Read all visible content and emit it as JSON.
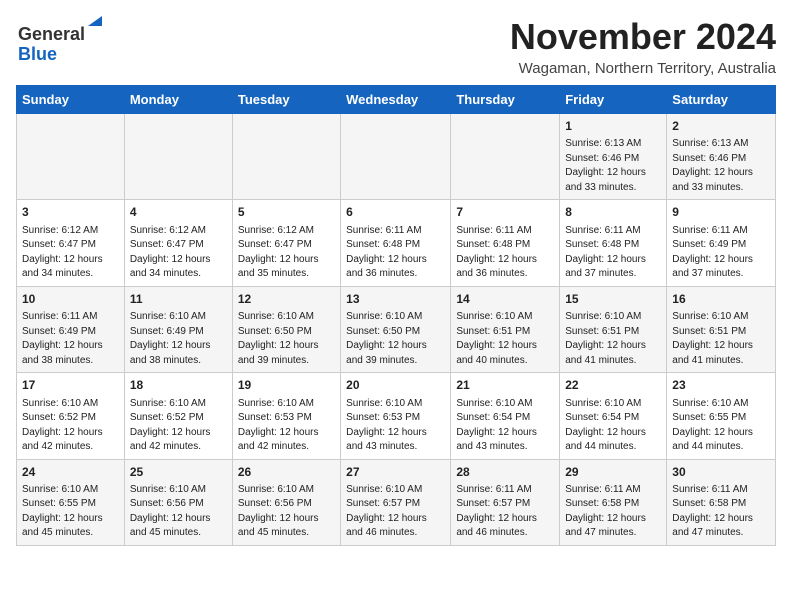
{
  "header": {
    "logo_line1": "General",
    "logo_line2": "Blue",
    "month_title": "November 2024",
    "subtitle": "Wagaman, Northern Territory, Australia"
  },
  "calendar": {
    "days_of_week": [
      "Sunday",
      "Monday",
      "Tuesday",
      "Wednesday",
      "Thursday",
      "Friday",
      "Saturday"
    ],
    "weeks": [
      [
        {
          "day": "",
          "info": ""
        },
        {
          "day": "",
          "info": ""
        },
        {
          "day": "",
          "info": ""
        },
        {
          "day": "",
          "info": ""
        },
        {
          "day": "",
          "info": ""
        },
        {
          "day": "1",
          "info": "Sunrise: 6:13 AM\nSunset: 6:46 PM\nDaylight: 12 hours and 33 minutes."
        },
        {
          "day": "2",
          "info": "Sunrise: 6:13 AM\nSunset: 6:46 PM\nDaylight: 12 hours and 33 minutes."
        }
      ],
      [
        {
          "day": "3",
          "info": "Sunrise: 6:12 AM\nSunset: 6:47 PM\nDaylight: 12 hours and 34 minutes."
        },
        {
          "day": "4",
          "info": "Sunrise: 6:12 AM\nSunset: 6:47 PM\nDaylight: 12 hours and 34 minutes."
        },
        {
          "day": "5",
          "info": "Sunrise: 6:12 AM\nSunset: 6:47 PM\nDaylight: 12 hours and 35 minutes."
        },
        {
          "day": "6",
          "info": "Sunrise: 6:11 AM\nSunset: 6:48 PM\nDaylight: 12 hours and 36 minutes."
        },
        {
          "day": "7",
          "info": "Sunrise: 6:11 AM\nSunset: 6:48 PM\nDaylight: 12 hours and 36 minutes."
        },
        {
          "day": "8",
          "info": "Sunrise: 6:11 AM\nSunset: 6:48 PM\nDaylight: 12 hours and 37 minutes."
        },
        {
          "day": "9",
          "info": "Sunrise: 6:11 AM\nSunset: 6:49 PM\nDaylight: 12 hours and 37 minutes."
        }
      ],
      [
        {
          "day": "10",
          "info": "Sunrise: 6:11 AM\nSunset: 6:49 PM\nDaylight: 12 hours and 38 minutes."
        },
        {
          "day": "11",
          "info": "Sunrise: 6:10 AM\nSunset: 6:49 PM\nDaylight: 12 hours and 38 minutes."
        },
        {
          "day": "12",
          "info": "Sunrise: 6:10 AM\nSunset: 6:50 PM\nDaylight: 12 hours and 39 minutes."
        },
        {
          "day": "13",
          "info": "Sunrise: 6:10 AM\nSunset: 6:50 PM\nDaylight: 12 hours and 39 minutes."
        },
        {
          "day": "14",
          "info": "Sunrise: 6:10 AM\nSunset: 6:51 PM\nDaylight: 12 hours and 40 minutes."
        },
        {
          "day": "15",
          "info": "Sunrise: 6:10 AM\nSunset: 6:51 PM\nDaylight: 12 hours and 41 minutes."
        },
        {
          "day": "16",
          "info": "Sunrise: 6:10 AM\nSunset: 6:51 PM\nDaylight: 12 hours and 41 minutes."
        }
      ],
      [
        {
          "day": "17",
          "info": "Sunrise: 6:10 AM\nSunset: 6:52 PM\nDaylight: 12 hours and 42 minutes."
        },
        {
          "day": "18",
          "info": "Sunrise: 6:10 AM\nSunset: 6:52 PM\nDaylight: 12 hours and 42 minutes."
        },
        {
          "day": "19",
          "info": "Sunrise: 6:10 AM\nSunset: 6:53 PM\nDaylight: 12 hours and 42 minutes."
        },
        {
          "day": "20",
          "info": "Sunrise: 6:10 AM\nSunset: 6:53 PM\nDaylight: 12 hours and 43 minutes."
        },
        {
          "day": "21",
          "info": "Sunrise: 6:10 AM\nSunset: 6:54 PM\nDaylight: 12 hours and 43 minutes."
        },
        {
          "day": "22",
          "info": "Sunrise: 6:10 AM\nSunset: 6:54 PM\nDaylight: 12 hours and 44 minutes."
        },
        {
          "day": "23",
          "info": "Sunrise: 6:10 AM\nSunset: 6:55 PM\nDaylight: 12 hours and 44 minutes."
        }
      ],
      [
        {
          "day": "24",
          "info": "Sunrise: 6:10 AM\nSunset: 6:55 PM\nDaylight: 12 hours and 45 minutes."
        },
        {
          "day": "25",
          "info": "Sunrise: 6:10 AM\nSunset: 6:56 PM\nDaylight: 12 hours and 45 minutes."
        },
        {
          "day": "26",
          "info": "Sunrise: 6:10 AM\nSunset: 6:56 PM\nDaylight: 12 hours and 45 minutes."
        },
        {
          "day": "27",
          "info": "Sunrise: 6:10 AM\nSunset: 6:57 PM\nDaylight: 12 hours and 46 minutes."
        },
        {
          "day": "28",
          "info": "Sunrise: 6:11 AM\nSunset: 6:57 PM\nDaylight: 12 hours and 46 minutes."
        },
        {
          "day": "29",
          "info": "Sunrise: 6:11 AM\nSunset: 6:58 PM\nDaylight: 12 hours and 47 minutes."
        },
        {
          "day": "30",
          "info": "Sunrise: 6:11 AM\nSunset: 6:58 PM\nDaylight: 12 hours and 47 minutes."
        }
      ]
    ]
  }
}
